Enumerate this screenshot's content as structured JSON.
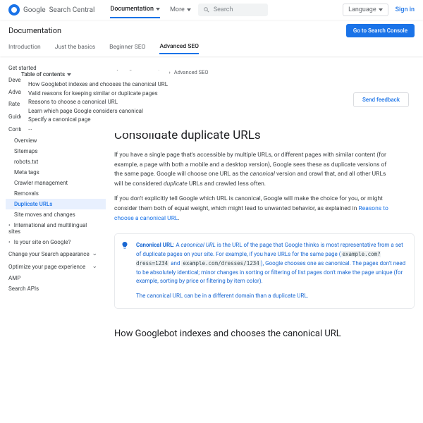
{
  "header": {
    "logo_prefix": "Google",
    "logo_suffix": "Search Central",
    "nav": [
      "Documentation",
      "More"
    ],
    "search_placeholder": "Search",
    "language_label": "Language",
    "signin": "Sign in"
  },
  "row2": {
    "title": "Documentation",
    "cta": "Go to Search Console"
  },
  "tabs": [
    "Introduction",
    "Just the basics",
    "Beginner SEO",
    "Advanced SEO"
  ],
  "active_tab": 3,
  "leftnav": {
    "items": [
      "Get started",
      "Developer's guide to Search",
      "Advanced guide to Search Console",
      "Rate and review",
      "Guidelines",
      "Control crawling and indexing",
      "Overview",
      "Sitemaps",
      "robots.txt",
      "Meta tags",
      "Crawler management",
      "Removals",
      "Duplicate URLs",
      "Site moves and changes",
      "International and multilingual sites",
      "Is your site on Google?",
      "Change your Search appearance",
      "Optimize your page experience",
      "AMP",
      "Search APIs"
    ]
  },
  "toc": {
    "head": "Table of contents",
    "rows": [
      "How Googlebot indexes and chooses the canonical URL",
      "Valid reasons for keeping similar or duplicate pages",
      "Reasons to choose a canonical URL",
      "Learn which page Google considers canonical",
      "Specify a canonical page",
      "…"
    ]
  },
  "crumbs": [
    "Home",
    "Documentation",
    "Advanced SEO"
  ],
  "feedback": "Send feedback",
  "h1": "Consolidate duplicate URLs",
  "p1_a": "If you have a single page that's accessible by multiple URLs, or different pages with similar content (for example, a page with both a mobile and a desktop version), Google sees these as duplicate versions of the same page. Google will choose one URL as the ",
  "p1_i": "canonical",
  "p1_b": " version and crawl that, and all other URLs will be considered ",
  "p1_i2": "duplicate",
  "p1_c": " URLs and crawled less often.",
  "p2_a": "If you don't explicitly tell Google which URL is canonical, Google will make the choice for you, or might consider them both of equal weight, which might lead to unwanted behavior, as explained in ",
  "p2_link": "Reasons to choose a canonical URL",
  "p2_b": ".",
  "callout": {
    "lead": "Canonical URL",
    "body_a": ": A ",
    "body_i": "canonical URL",
    "body_b": " is the URL of the page that Google thinks is most representative from a set of duplicate pages on your site. For example, if you have URLs for the same page (",
    "code1": "example.com?dress=1234",
    "mid": " and ",
    "code2": "example.com/dresses/1234",
    "body_c": "), Google chooses one as canonical. The pages don't need to be absolutely identical; minor changes in sorting or filtering of list pages don't make the page unique (for example, sorting by price or filtering by item color).",
    "line2": "The canonical URL can be in a different domain than a duplicate URL."
  },
  "h2": "How Googlebot indexes and chooses the canonical URL"
}
